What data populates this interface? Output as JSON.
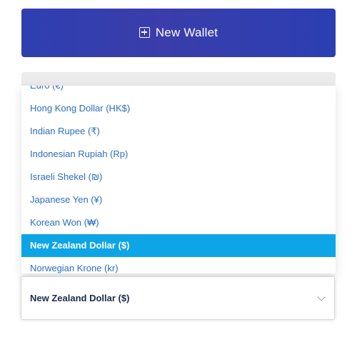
{
  "new_wallet": {
    "label": "New Wallet",
    "icon": "plus-square-icon"
  },
  "currency_dropdown": {
    "options": [
      {
        "label": "Euro (€)"
      },
      {
        "label": "Hong Kong Dollar (HK$)"
      },
      {
        "label": "Indian Rupee (₹)"
      },
      {
        "label": "Indonesian Rupiah (Rp)"
      },
      {
        "label": "Israeli Shekel (₪)"
      },
      {
        "label": "Japanese Yen (¥)"
      },
      {
        "label": "Korean Won (₩)"
      },
      {
        "label": "New Zealand Dollar ($)"
      },
      {
        "label": "Norwegian Krone (kr)"
      }
    ],
    "selected_value": "New Zealand Dollar ($)"
  },
  "colors": {
    "button_gradient_start": "#2f3fb0",
    "button_gradient_end": "#2b3fb2",
    "option_text": "#2c6fbf",
    "selected_bg": "#0da5e6",
    "selected_text": "#ffffff"
  }
}
